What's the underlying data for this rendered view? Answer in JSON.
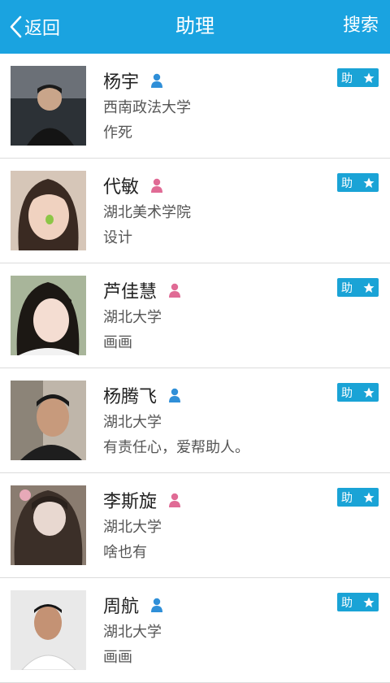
{
  "header": {
    "back_label": "返回",
    "title": "助理",
    "search_label": "搜索"
  },
  "colors": {
    "accent": "#1aa3e0",
    "male": "#2f8fd8",
    "female": "#e06b95"
  },
  "badge_label": "助",
  "users": [
    {
      "name": "杨宇",
      "gender": "male",
      "school": "西南政法大学",
      "desc": "作死"
    },
    {
      "name": "代敏",
      "gender": "female",
      "school": "湖北美术学院",
      "desc": "设计"
    },
    {
      "name": "芦佳慧",
      "gender": "female",
      "school": "湖北大学",
      "desc": "画画"
    },
    {
      "name": "杨腾飞",
      "gender": "male",
      "school": "湖北大学",
      "desc": "有责任心，爱帮助人。"
    },
    {
      "name": "李斯旋",
      "gender": "female",
      "school": "湖北大学",
      "desc": "啥也有"
    },
    {
      "name": "周航",
      "gender": "male",
      "school": "湖北大学",
      "desc": "画画"
    }
  ]
}
